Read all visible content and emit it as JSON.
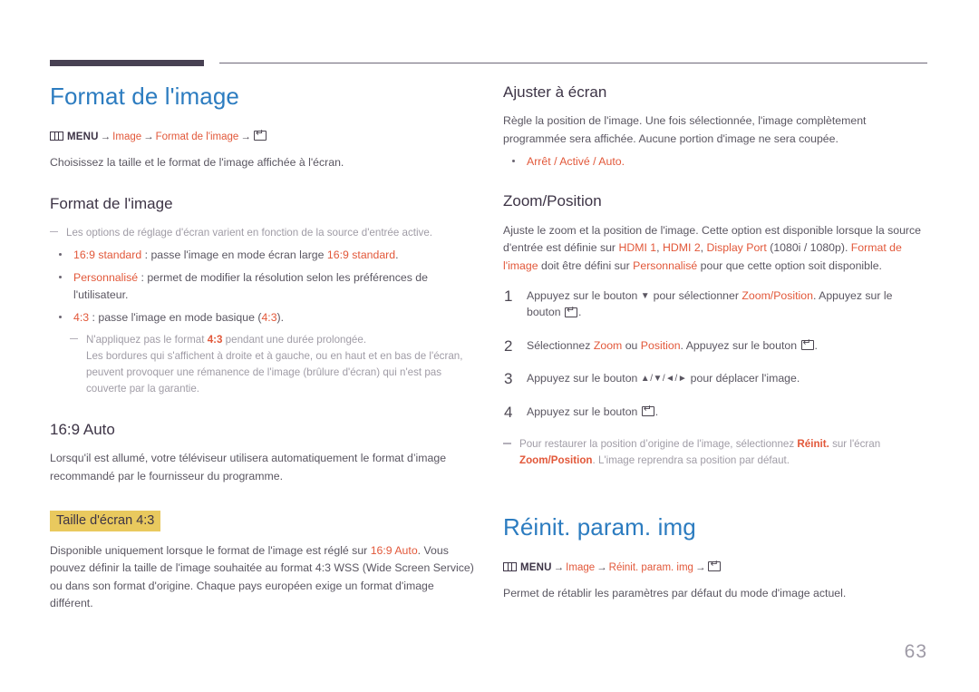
{
  "page": {
    "number": "63"
  },
  "left": {
    "title": "Format de l'image",
    "breadcrumb": {
      "menu": "MENU",
      "arrow": "→",
      "item1": "Image",
      "item2": "Format de l'image"
    },
    "lead": "Choisissez la taille et le format de l'image affichée à l'écran.",
    "section1": {
      "heading": "Format de l'image",
      "note": "Les options de réglage d'écran varient en fonction de la source d'entrée active.",
      "bullets": [
        {
          "term": "16:9 standard",
          "sep": " : ",
          "text_before": "passe l'image en mode écran large ",
          "accent2": "16:9 standard",
          "text_after": "."
        },
        {
          "term": "Personnalisé",
          "sep": " : ",
          "text_before": "permet de modifier la résolution selon les préférences de l'utilisateur.",
          "accent2": "",
          "text_after": ""
        },
        {
          "term": "4:3",
          "sep": " : ",
          "text_before": "passe l'image en mode basique (",
          "accent2": "4:3",
          "text_after": ")."
        }
      ],
      "subnote_part1": "N'appliquez pas le format ",
      "subnote_accent": "4:3",
      "subnote_part2": " pendant une durée prolongée.",
      "subnote_line2": "Les bordures qui s'affichent à droite et à gauche, ou en haut et en bas de l'écran, peuvent provoquer une rémanence de l'image (brûlure d'écran) qui n'est pas couverte par la garantie."
    },
    "section2": {
      "heading": "16:9 Auto",
      "body": "Lorsqu'il est allumé, votre téléviseur utilisera automatiquement le format d’image recommandé par le fournisseur du programme.",
      "highlight_heading": "Taille d'écran 4:3",
      "body2_part1": "Disponible uniquement lorsque le format de l'image est réglé sur ",
      "body2_accent": "16:9 Auto",
      "body2_part2": ". Vous pouvez définir la taille de l'image souhaitée au format 4:3 WSS (Wide Screen Service) ou dans son format d'origine. Chaque pays européen exige un format d'image différent."
    }
  },
  "right": {
    "section1": {
      "heading": "Ajuster à écran",
      "body": "Règle la position de l'image. Une fois sélectionnée, l'image complètement programmée sera affichée. Aucune portion d'image ne sera coupée.",
      "options": "Arrêt / Activé / Auto."
    },
    "section2": {
      "heading": "Zoom/Position",
      "intro_p1": "Ajuste le zoom et la position de l'image. Cette option est disponible lorsque la source d'entrée est définie sur ",
      "intro_a1": "HDMI 1",
      "intro_p2": ", ",
      "intro_a2": "HDMI 2",
      "intro_p3": ", ",
      "intro_a3": "Display Port",
      "intro_p4": " (1080i / 1080p). ",
      "intro_a4": "Format de l'image",
      "intro_p5": " doit être défini sur ",
      "intro_a5": "Personnalisé",
      "intro_p6": " pour que cette option soit disponible.",
      "steps": [
        {
          "num": "1",
          "p1": "Appuyez sur le bouton ",
          "glyph": "▼",
          "p2": " pour sélectionner ",
          "accent": "Zoom/Position",
          "p3": ". Appuyez sur le bouton ",
          "p4": "."
        },
        {
          "num": "2",
          "p1": "Sélectionnez ",
          "glyph": "",
          "accent": "Zoom",
          "p2": " ou ",
          "accent2": "Position",
          "p3": ". Appuyez sur le bouton ",
          "p4": "."
        },
        {
          "num": "3",
          "p1": "Appuyez sur le bouton ",
          "glyph": "▲/▼/◄/►",
          "p2": " pour déplacer l'image.",
          "p3": "",
          "p4": ""
        },
        {
          "num": "4",
          "p1": "Appuyez sur le bouton ",
          "glyph": "",
          "p2": "",
          "p3": "",
          "p4": "."
        }
      ],
      "note_p1": "Pour restaurer la position d’origine de l'image, sélectionnez ",
      "note_a1": "Réinit.",
      "note_p2": " sur l'écran ",
      "note_a2": "Zoom/Position",
      "note_p3": ". L'image reprendra sa position par défaut."
    },
    "section3": {
      "title": "Réinit. param. img",
      "breadcrumb": {
        "menu": "MENU",
        "arrow": "→",
        "item1": "Image",
        "item2": "Réinit. param. img"
      },
      "body": "Permet de rétablir les paramètres par défaut du mode d'image actuel."
    }
  }
}
